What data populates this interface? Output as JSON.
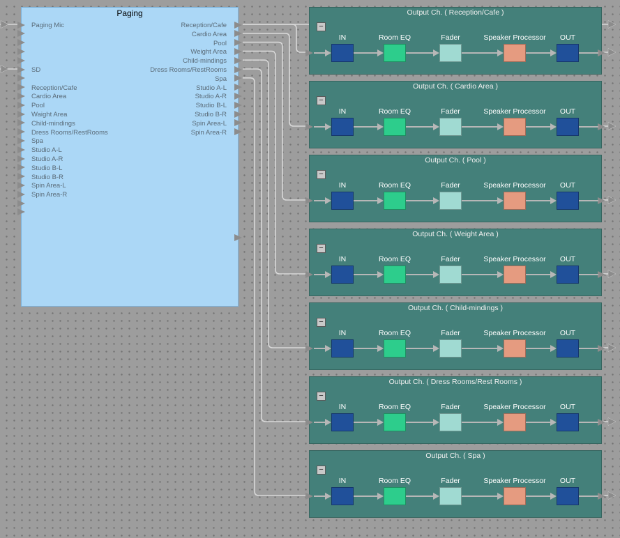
{
  "canvas": {
    "bg": "#9d9d9d",
    "dot_color": "#747474"
  },
  "colors": {
    "paging_fill": "#abd7f6",
    "paging_border": "#7db2da",
    "paging_title": "#000000",
    "paging_label": "#5a6b78",
    "block_fill": "#44807a",
    "block_border": "#36655f",
    "block_title": "#efefef",
    "chain_label": "#ffffff",
    "wire": "#d8d8d8",
    "port": "#8c8c8c",
    "arrow": "#b7b7b7",
    "collapse_bg": "#c9c9c9",
    "in_out_fill": "#20509a",
    "room_eq_fill": "#2dcd8c",
    "fader_fill": "#a0dad2",
    "speaker_processor_fill": "#e59b80"
  },
  "paging": {
    "title": "Paging",
    "inputs": [
      "Paging Mic",
      "",
      "",
      "",
      "",
      "SD",
      "",
      "Reception/Cafe",
      "Cardio Area",
      "Pool",
      "Waight Area",
      "Child-mindings",
      "Dress Rooms/RestRooms",
      "Spa",
      "Studio A-L",
      "Studio A-R",
      "Studio B-L",
      "Studio B-R",
      "Spin Area-L",
      "Spin Area-R",
      "",
      ""
    ],
    "outputs": [
      "Reception/Cafe",
      "Cardio Area",
      "Pool",
      "Weight Area",
      "Child-mindings",
      "Dress Rooms/RestRooms",
      "Spa",
      "Studio A-L",
      "Studio A-R",
      "Studio B-L",
      "Studio B-R",
      "Spin Area-L",
      "Spin Area-R"
    ]
  },
  "output_blocks": [
    {
      "title": "Output Ch. ( Reception/Cafe )"
    },
    {
      "title": "Output Ch. ( Cardio Area )"
    },
    {
      "title": "Output Ch. ( Pool )"
    },
    {
      "title": "Output Ch. ( Weight Area )"
    },
    {
      "title": "Output Ch. ( Child-mindings )"
    },
    {
      "title": "Output Ch. ( Dress Rooms/Rest Rooms )"
    },
    {
      "title": "Output Ch. ( Spa )"
    }
  ],
  "chain": [
    {
      "label": "IN",
      "name": "in-node",
      "color_key": "in_out_fill"
    },
    {
      "label": "Room EQ",
      "name": "room-eq-node",
      "color_key": "room_eq_fill"
    },
    {
      "label": "Fader",
      "name": "fader-node",
      "color_key": "fader_fill"
    },
    {
      "label": "Speaker Processor",
      "name": "speaker-processor-node",
      "color_key": "speaker_processor_fill"
    },
    {
      "label": "OUT",
      "name": "out-node",
      "color_key": "in_out_fill"
    }
  ],
  "collapse_button_label": "−"
}
